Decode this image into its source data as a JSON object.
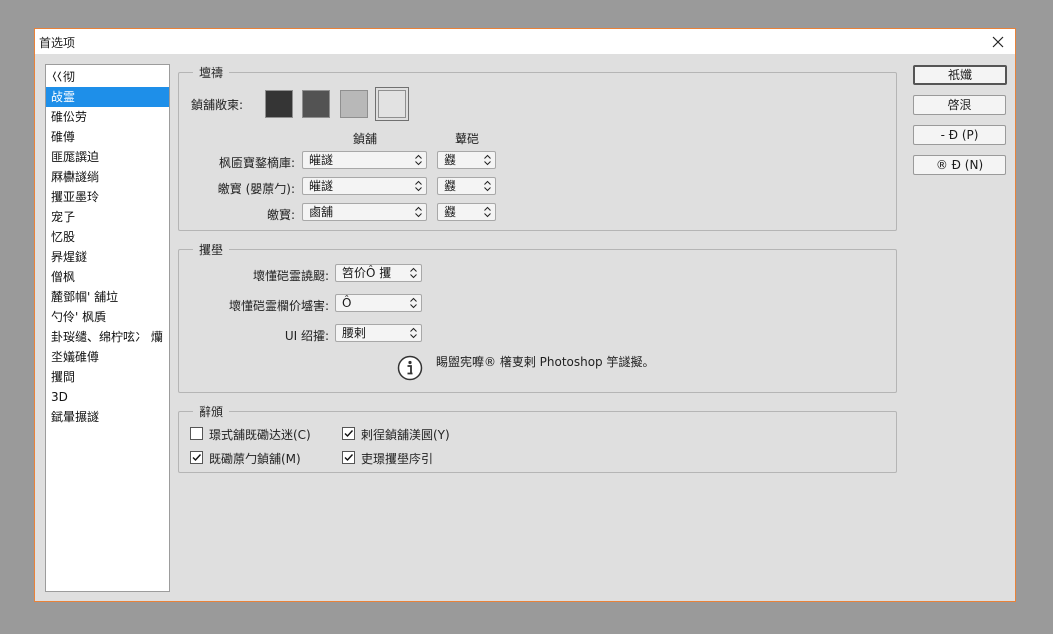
{
  "window": {
    "title": "首选项"
  },
  "sidebar": {
    "items": [
      {
        "label": "巜彻",
        "active": false
      },
      {
        "label": "敁霊",
        "active": true
      },
      {
        "label": "碓伀劳",
        "active": false
      },
      {
        "label": "碓僔",
        "active": false
      },
      {
        "label": "匪厖譔迫",
        "active": false
      },
      {
        "label": "厤欁譢绱",
        "active": false
      },
      {
        "label": "攫亚墨玲",
        "active": false
      },
      {
        "label": "宠孒",
        "active": false
      },
      {
        "label": "忆股",
        "active": false
      },
      {
        "label": "昦煋鐩",
        "active": false
      },
      {
        "label": "僧枫",
        "active": false
      },
      {
        "label": "麓鄧帼' 舖垃",
        "active": false
      },
      {
        "label": "勺伶' 枫貭",
        "active": false
      },
      {
        "label": "卦珱缱、绵柠呟冫 爤",
        "active": false
      },
      {
        "label": "坔嬟碓僔",
        "active": false
      },
      {
        "label": "攫閊",
        "active": false
      },
      {
        "label": "3D",
        "active": false
      },
      {
        "label": "錻暈搌譢",
        "active": false
      }
    ]
  },
  "appearance": {
    "legend": "壇禱",
    "color_theme_label": "鍞舖敞柬:",
    "swatches": [
      {
        "color": "#353535",
        "selected": false
      },
      {
        "color": "#535353",
        "selected": false
      },
      {
        "color": "#b8b8b8",
        "selected": false
      },
      {
        "color": "#e2e2e2",
        "selected": true
      }
    ],
    "col_color": "鍞舖",
    "col_border": "鼙硙",
    "rows": [
      {
        "label": "枫匬寶鍪樀庫:",
        "color": "皠譢",
        "border": "鼝"
      },
      {
        "label": "皦寳 (嬰蒝勹):",
        "color": "皠譢",
        "border": "鼝"
      },
      {
        "label": "皦寳:",
        "color": "鹵舖",
        "border": "鼝"
      }
    ]
  },
  "text": {
    "legend": "攫壆",
    "rows": [
      {
        "label": "壞懂硙霊譊颬:",
        "value": "笤价Ô 攫"
      },
      {
        "label": "壞懂硙霊欄价墭害:",
        "value": "Ô"
      },
      {
        "label": "UI 绍攉:",
        "value": "腰剌"
      }
    ],
    "info_text": "睗盥宪嚤®   櫡叓剌 Photoshop 竽譢擬。"
  },
  "options": {
    "legend": "辭頒",
    "checkboxes": [
      {
        "label": "璟式舖既磡达迷(C)",
        "checked": false
      },
      {
        "label": "剌徎鍞舖渼囻(Y)",
        "checked": true
      },
      {
        "label": "既磡蒝勹鍞舖(M)",
        "checked": true
      },
      {
        "label": "吏璟攫壆庈引",
        "checked": true
      }
    ]
  },
  "buttons": {
    "ok": "祇孅",
    "cancel": "啓泿",
    "prev": "-   Ð (P)",
    "next": "®   Ð (N)"
  },
  "icons": {
    "close": "close-icon",
    "info": "info-icon",
    "checkmark": "checkmark-icon",
    "select_arrows": "chevron-up-down-icon"
  }
}
